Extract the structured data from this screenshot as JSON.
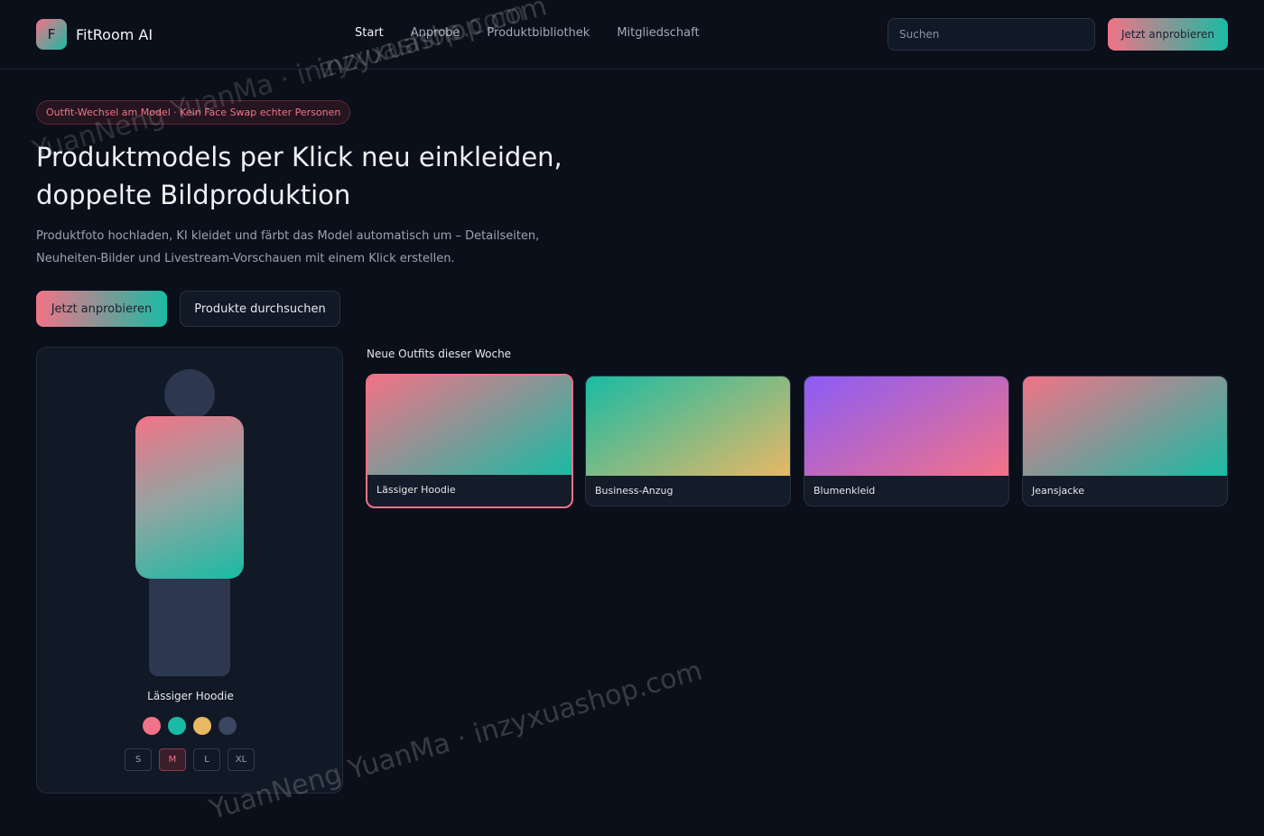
{
  "header": {
    "logo_letter": "F",
    "brand": "FitRoom AI",
    "nav": [
      "Start",
      "Anprobe",
      "Produktbibliothek",
      "Mitgliedschaft"
    ],
    "active_nav": "Start",
    "search_placeholder": "Suchen",
    "cta_label": "Jetzt anprobieren"
  },
  "hero": {
    "badge": "Outfit-Wechsel am Model · Kein Face Swap echter Personen",
    "title_line1": "Produktmodels per Klick neu einkleiden,",
    "title_line2": "doppelte Bildproduktion",
    "subtitle_line1": "Produktfoto hochladen, KI kleidet und färbt das Model automatisch um – Detailseiten,",
    "subtitle_line2": "Neuheiten-Bilder und Livestream-Vorschauen mit einem Klick erstellen.",
    "primary_label": "Jetzt anprobieren",
    "secondary_label": "Produkte durchsuchen"
  },
  "preview": {
    "outfit_name": "Lässiger Hoodie",
    "swatch_colors": [
      "#f27387",
      "#19bba4",
      "#e8b865",
      "#3b4660"
    ],
    "sizes": [
      "S",
      "M",
      "L",
      "XL"
    ],
    "selected_size": "M"
  },
  "outfits": {
    "heading": "Neue Outfits dieser Woche",
    "items": [
      {
        "name": "Lässiger Hoodie",
        "gradient_from": "#f27387",
        "gradient_to": "#19bba4",
        "selected": true
      },
      {
        "name": "Business-Anzug",
        "gradient_from": "#19bba4",
        "gradient_to": "#e8b865",
        "selected": false
      },
      {
        "name": "Blumenkleid",
        "gradient_from": "#8b5cf6",
        "gradient_to": "#f27387",
        "selected": false
      },
      {
        "name": "Jeansjacke",
        "gradient_from": "#f27387",
        "gradient_to": "#19bba4",
        "selected": false
      }
    ]
  },
  "watermark": {
    "text_top_a": "inzyxuashop.com",
    "text_top_b": "YuanNeng YuanMa · inzyxuashop.com",
    "text_bottom": "YuanNeng YuanMa · inzyxuashop.com"
  },
  "colors": {
    "background": "#0a0f1a",
    "accent_pink": "#f27387",
    "accent_teal": "#19bba4"
  }
}
